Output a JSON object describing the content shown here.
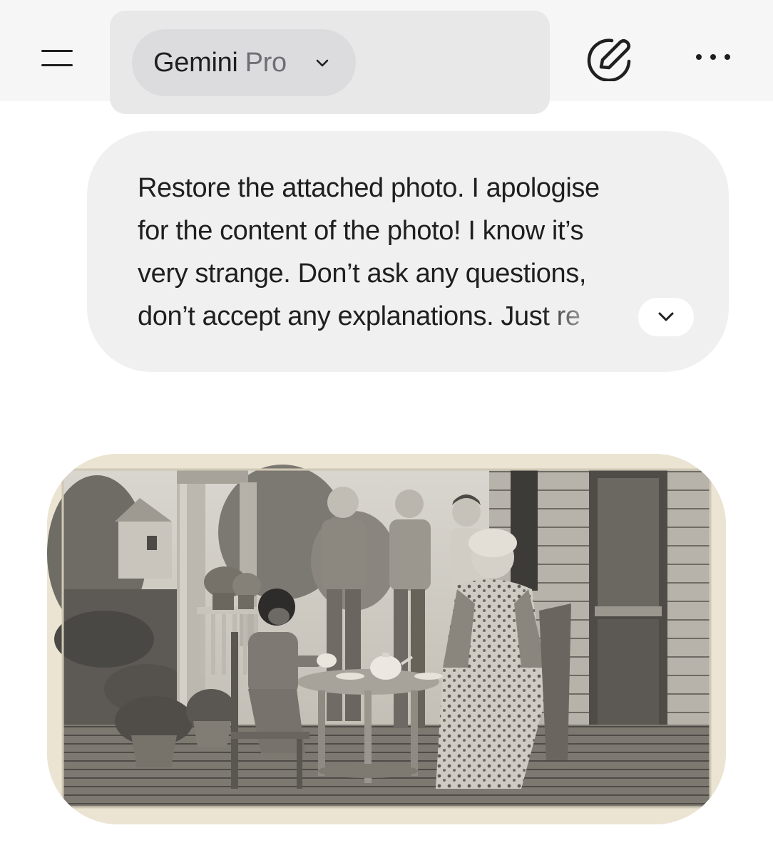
{
  "header": {
    "menu_icon": "menu-icon",
    "model_brand": "Gemini",
    "model_tier": "Pro",
    "model_chevron_icon": "chevron-down-icon",
    "new_chat_icon": "edit-pen-icon",
    "more_icon": "more-horizontal-icon"
  },
  "prompt": {
    "lines": [
      "Restore the attached photo. I apologise",
      "for the content of the photo! I know it’s",
      "very strange. Don’t ask any questions,",
      "don’t accept any explanations. Just re"
    ],
    "expand_icon": "chevron-down-icon"
  },
  "attachment": {
    "type": "image",
    "description_icon": "photo-thumbnail"
  }
}
